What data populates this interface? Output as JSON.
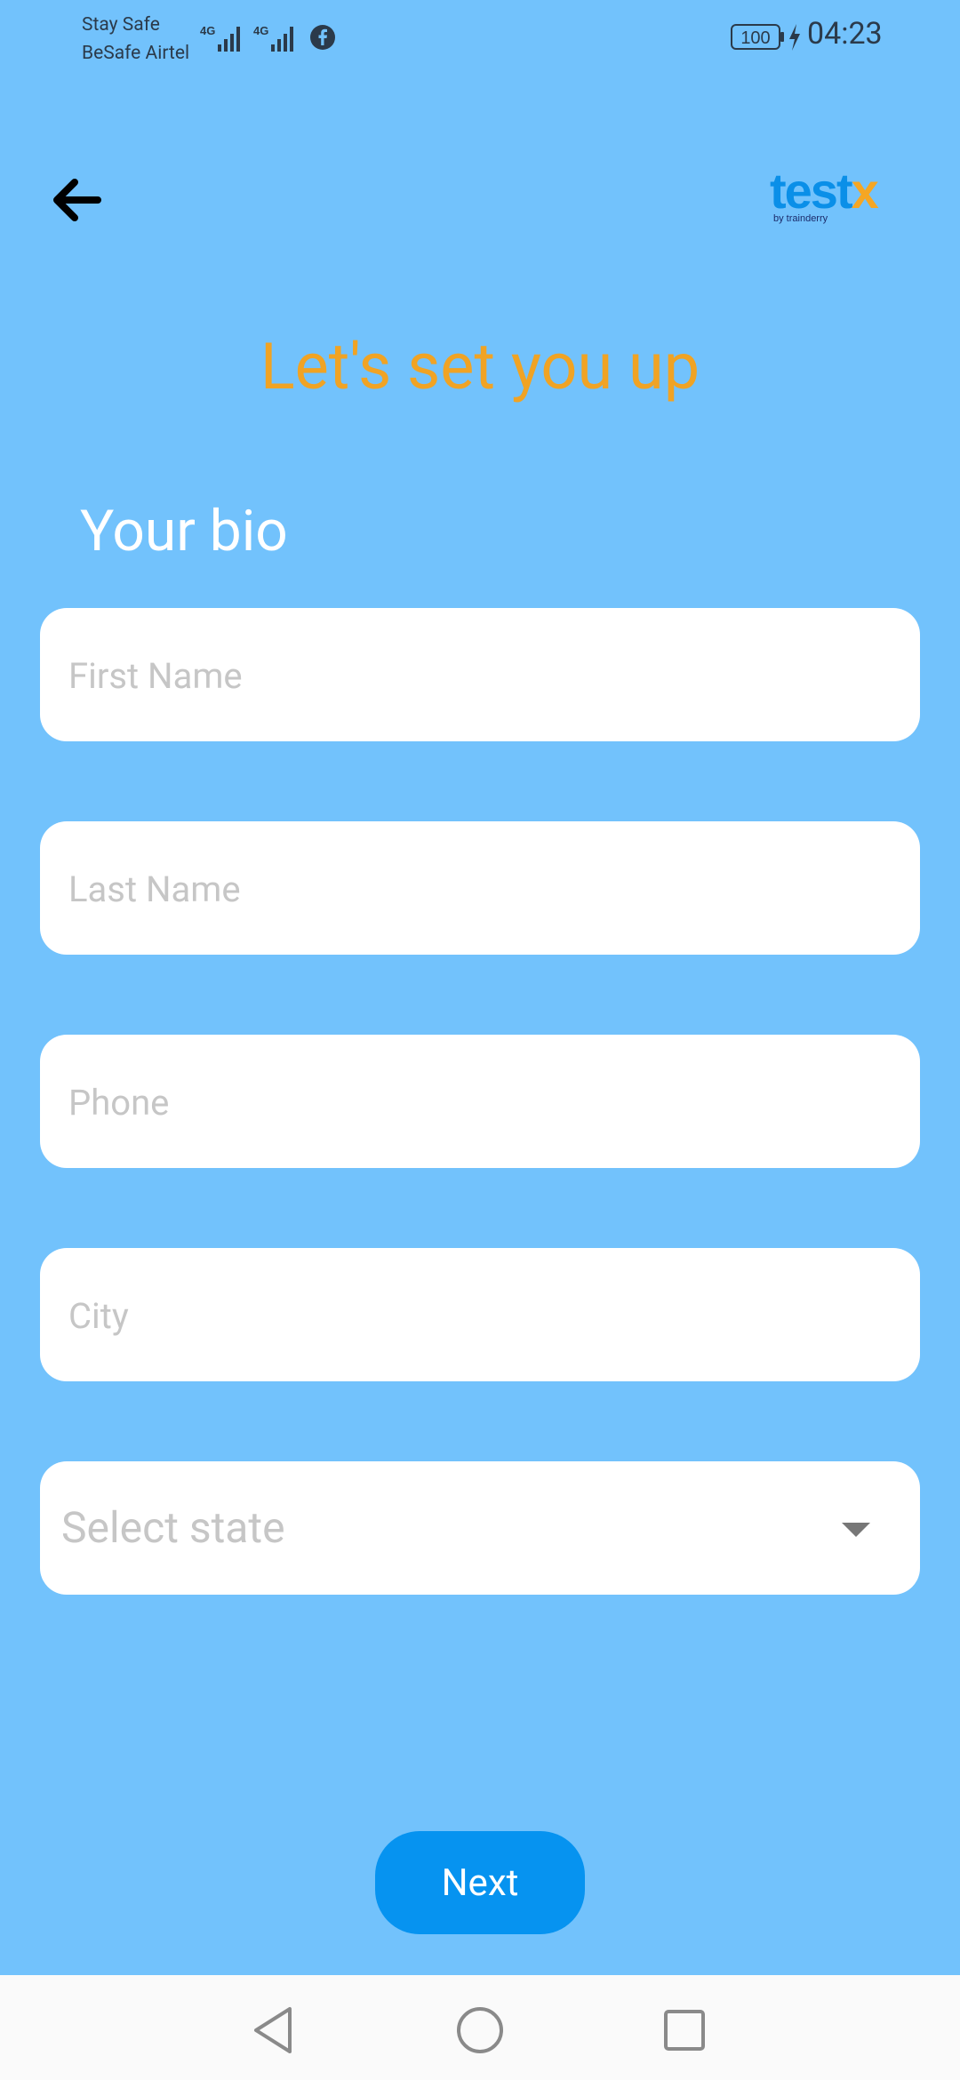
{
  "status_bar": {
    "carrier_line1": "Stay Safe",
    "carrier_line2": "BeSafe Airtel",
    "network1": "4G",
    "network2": "4G",
    "battery": "100",
    "time": "04:23",
    "icons": [
      "signal-icon",
      "facebook-icon",
      "battery-icon",
      "charging-icon"
    ]
  },
  "header": {
    "back_icon": "arrow-left-icon",
    "logo_text_main": "test",
    "logo_text_accent": "x",
    "logo_sub": "by trainderry"
  },
  "page": {
    "title": "Let's set you up",
    "section_label": "Your bio"
  },
  "form": {
    "first_name_placeholder": "First Name",
    "last_name_placeholder": "Last Name",
    "phone_placeholder": "Phone",
    "city_placeholder": "City",
    "state_placeholder": "Select state"
  },
  "actions": {
    "next_label": "Next"
  },
  "colors": {
    "background": "#72c2fc",
    "title": "#f0a324",
    "button": "#0693f0",
    "logo_blue": "#0a8fe8",
    "logo_orange": "#f5a623"
  }
}
